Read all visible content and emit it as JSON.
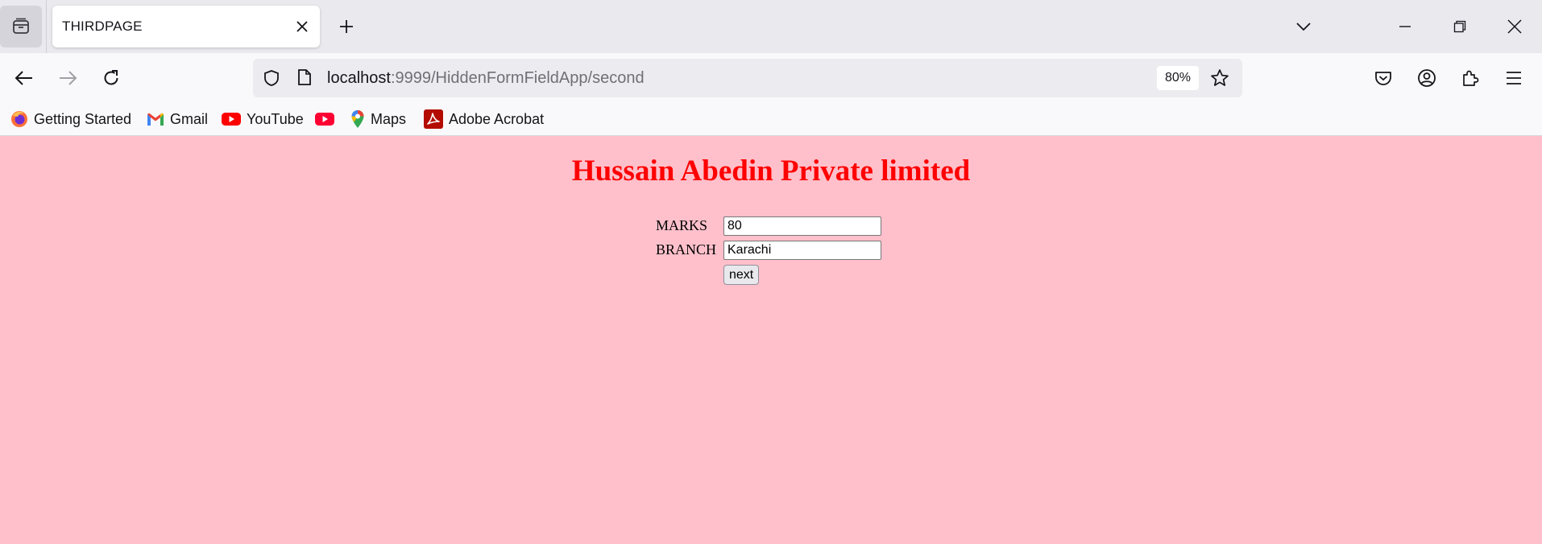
{
  "browser": {
    "tab": {
      "title": "THIRDPAGE"
    },
    "url": {
      "host": "localhost",
      "path": ":9999/HiddenFormFieldApp/second"
    },
    "zoom": "80%",
    "bookmarks": [
      {
        "label": "Getting Started",
        "icon": "firefox-icon"
      },
      {
        "label": "Gmail",
        "icon": "gmail-icon"
      },
      {
        "label": "YouTube",
        "icon": "youtube-icon"
      },
      {
        "label": "",
        "icon": "youtube-icon"
      },
      {
        "label": "Maps",
        "icon": "maps-icon"
      },
      {
        "label": "Adobe Acrobat",
        "icon": "acrobat-icon"
      }
    ]
  },
  "page": {
    "heading": "Hussain Abedin Private limited",
    "form": {
      "marks_label": "MARKS",
      "marks_value": "80",
      "branch_label": "BRANCH",
      "branch_value": "Karachi",
      "next_label": "next"
    }
  },
  "colors": {
    "page_background": "#ffc0cb",
    "heading": "#ff0000"
  }
}
